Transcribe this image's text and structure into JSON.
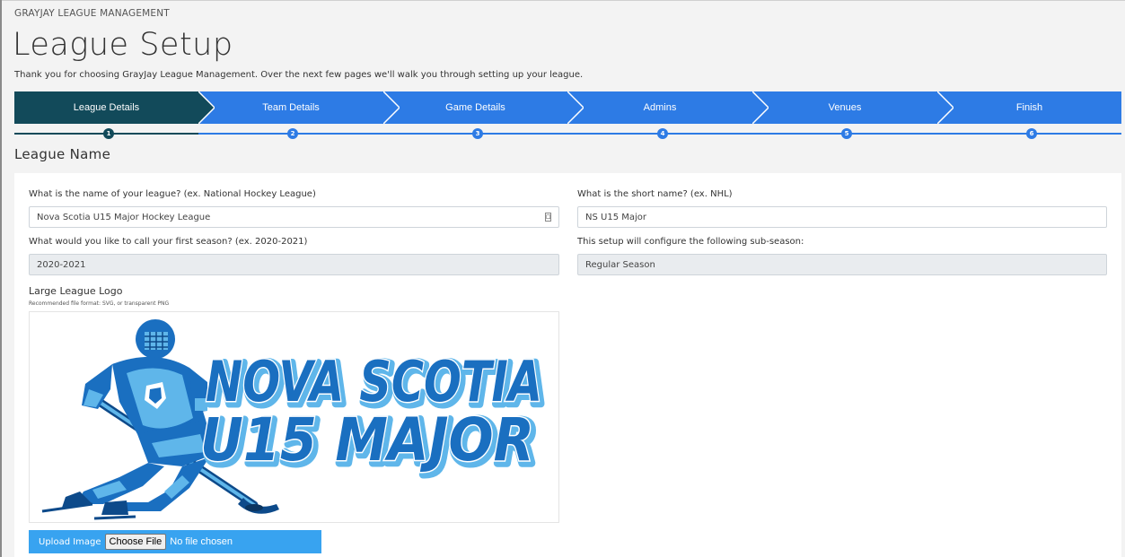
{
  "app": {
    "brand": "GRAYJAY LEAGUE MANAGEMENT"
  },
  "header": {
    "title": "League Setup",
    "intro": "Thank you for choosing GrayJay League Management. Over the next few pages we'll walk you through setting up your league."
  },
  "wizard": {
    "steps": [
      {
        "label": "League Details",
        "number": "1",
        "active": true
      },
      {
        "label": "Team Details",
        "number": "2",
        "active": false
      },
      {
        "label": "Game Details",
        "number": "3",
        "active": false
      },
      {
        "label": "Admins",
        "number": "4",
        "active": false
      },
      {
        "label": "Venues",
        "number": "5",
        "active": false
      },
      {
        "label": "Finish",
        "number": "6",
        "active": false
      }
    ]
  },
  "section": {
    "title": "League Name"
  },
  "form": {
    "league_name_label": "What is the name of your league? (ex. National Hockey League)",
    "league_name_value": "Nova Scotia U15 Major Hockey League",
    "short_name_label": "What is the short name? (ex. NHL)",
    "short_name_value": "NS U15 Major",
    "season_label": "What would you like to call your first season? (ex. 2020-2021)",
    "season_value": "2020-2021",
    "subseason_label": "This setup will configure the following sub-season:",
    "subseason_value": "Regular Season",
    "logo_label": "Large League Logo",
    "logo_hint": "Recommended file format: SVG, or transparent PNG"
  },
  "logo": {
    "line1": "NOVA SCOTIA",
    "line2": "U15 MAJOR"
  },
  "upload": {
    "label": "Upload Image",
    "button": "Choose File",
    "status": "No file chosen"
  },
  "colors": {
    "active_step": "#124a5a",
    "step": "#2d7be5",
    "upload_bar": "#38a3f0",
    "logo_blue": "#1a6fc0",
    "logo_light": "#5fb6ea"
  }
}
